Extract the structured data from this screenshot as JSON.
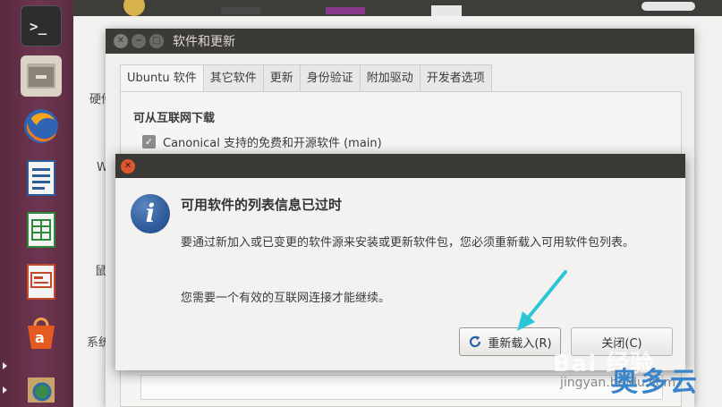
{
  "software_window": {
    "title": "软件和更新",
    "tabs": [
      "Ubuntu 软件",
      "其它软件",
      "更新",
      "身份验证",
      "附加驱动",
      "开发者选项"
    ],
    "section_title": "可从互联网下载",
    "checkbox_label": "Canonical 支持的免费和开源软件 (main)"
  },
  "background": {
    "label_hardware": "硬件",
    "label_w": "W",
    "label_personal": "鼠",
    "label_system": "系统"
  },
  "dialog": {
    "heading": "可用软件的列表信息已过时",
    "body": "要通过新加入或已变更的软件源来安装或更新软件包，您必须重新载入可用软件包列表。",
    "note": "您需要一个有效的互联网连接才能继续。",
    "reload_label": "重新载入(R)",
    "close_label": "关闭(C)"
  },
  "watermark": {
    "baidu": "Bai 经验",
    "url": "jingyan.baidu.com",
    "brand": "奥多云"
  },
  "colors": {
    "launcher": "#6e3550",
    "titlebar": "#3b3a37",
    "close_button": "#e1572d",
    "info_icon": "#2f5c9b",
    "arrow": "#2cc6d6"
  }
}
